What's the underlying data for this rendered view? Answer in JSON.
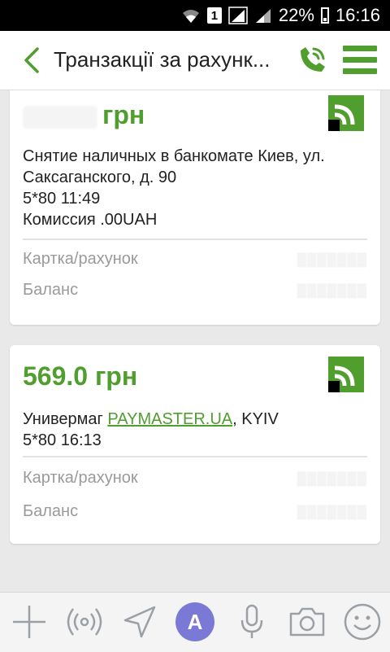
{
  "status_bar": {
    "sim_slot": "1",
    "battery": "22%",
    "time": "16:16",
    "icons": [
      "wifi-icon",
      "signal-icon",
      "signal-icon",
      "battery-icon"
    ]
  },
  "header": {
    "title": "Транзакції за рахунк...",
    "icons": [
      "back-arrow-icon",
      "phone-call-icon",
      "hamburger-menu-icon"
    ],
    "accent_color": "#4f9e2e"
  },
  "transactions": [
    {
      "amount": "грн",
      "amount_obscured": true,
      "merchant_prefix": "Снятие наличных в банкомате Киев, ул. Саксаганского, д. 90",
      "merchant_link": "",
      "merchant_suffix": "",
      "date_time": "5*80 11:49",
      "commission": "Комиссия  .00UAH",
      "card_label": "Картка/рахунок",
      "card_value": "",
      "balance_label": "Баланс",
      "balance_value": ""
    },
    {
      "amount": "569.0 грн",
      "amount_obscured": false,
      "merchant_prefix": "Универмаг ",
      "merchant_link": "PAYMASTER.UA",
      "merchant_suffix": ", KYIV",
      "date_time": "5*80 16:13",
      "commission": "",
      "card_label": "Картка/рахунок",
      "card_value": "",
      "balance_label": "Баланс",
      "balance_value": ""
    }
  ],
  "bottom_bar": {
    "icons": [
      "plus-icon",
      "broadcast-icon",
      "send-location-icon",
      "sticker-a-icon",
      "microphone-icon",
      "camera-icon",
      "smiley-icon"
    ],
    "sticker_letter": "A"
  }
}
